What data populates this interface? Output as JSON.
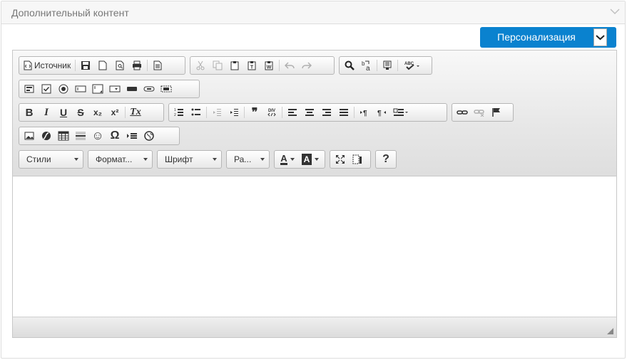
{
  "panel": {
    "title": "Дополнительный контент"
  },
  "personalization": {
    "label": "Персонализация"
  },
  "toolbar": {
    "source_label": "Источник",
    "combos": {
      "styles": "Стили",
      "format": "Формат...",
      "font": "Шрифт",
      "size": "Ра..."
    },
    "glyphs": {
      "bold": "B",
      "italic": "I",
      "underline": "U",
      "strike": "S",
      "subscript": "x₂",
      "superscript": "x²",
      "remove_format": "Tx",
      "blockquote": "❞",
      "omega": "Ω",
      "smiley": "☺",
      "help": "?",
      "text_color": "A",
      "bg_color": "A",
      "abc": "ABC"
    }
  },
  "colors": {
    "accent": "#0a82cf",
    "border": "#b6b6b6"
  }
}
